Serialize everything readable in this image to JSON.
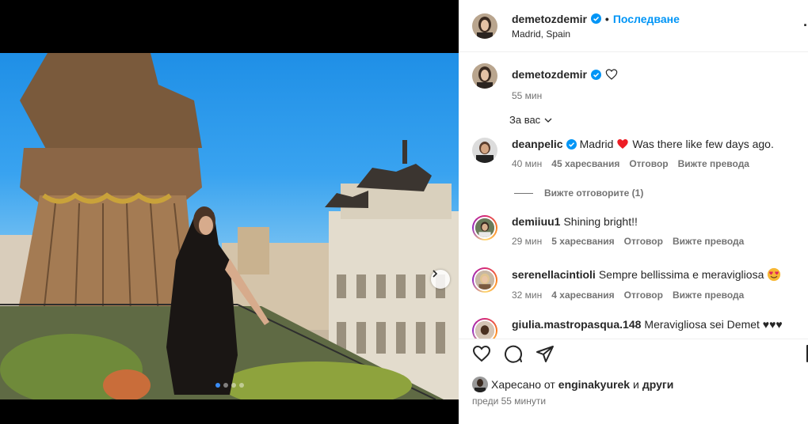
{
  "post": {
    "username": "demetozdemir",
    "separator": "•",
    "follow_label": "Последване",
    "location": "Madrid, Spain",
    "more_label": "·"
  },
  "caption": {
    "username": "demetozdemir",
    "time": "55 мин"
  },
  "comments_filter": {
    "label": "За вас"
  },
  "comments": [
    {
      "username": "deanpelic",
      "text_before": "Madrid",
      "text_after": "Was there like few days ago.",
      "time": "40 мин",
      "likes": "45 харесвания",
      "reply": "Отговор",
      "translate": "Вижте превода",
      "verified": true
    },
    {
      "username": "demiiuu1",
      "text": "Shining bright!!",
      "time": "29 мин",
      "likes": "5 харесвания",
      "reply": "Отговор",
      "translate": "Вижте превода"
    },
    {
      "username": "serenellacintioli",
      "text": "Sempre bellissima e meravigliosa",
      "time": "32 мин",
      "likes": "4 харесвания",
      "reply": "Отговор",
      "translate": "Вижте превода"
    },
    {
      "username": "giulia.mastropasqua.148",
      "text": "Meravigliosa sei Demet ♥♥♥"
    }
  ],
  "view_replies": "Вижте отговорите (1)",
  "likes_line": {
    "prefix": "Харесано от",
    "user": "enginakyurek",
    "conj": "и",
    "suffix": "други"
  },
  "post_time": "преди 55 минути",
  "icons": {
    "like": "heart-icon",
    "comment": "comment-icon",
    "share": "share-icon",
    "save": "bookmark-icon",
    "verified": "verified-badge-icon",
    "next": "chevron-right-icon",
    "dropdown": "chevron-down-icon"
  },
  "colors": {
    "accent": "#0095f6",
    "verified": "#0095f6",
    "muted": "#737373",
    "red_heart": "#ed1c24"
  },
  "carousel": {
    "total": 4,
    "active": 1
  }
}
